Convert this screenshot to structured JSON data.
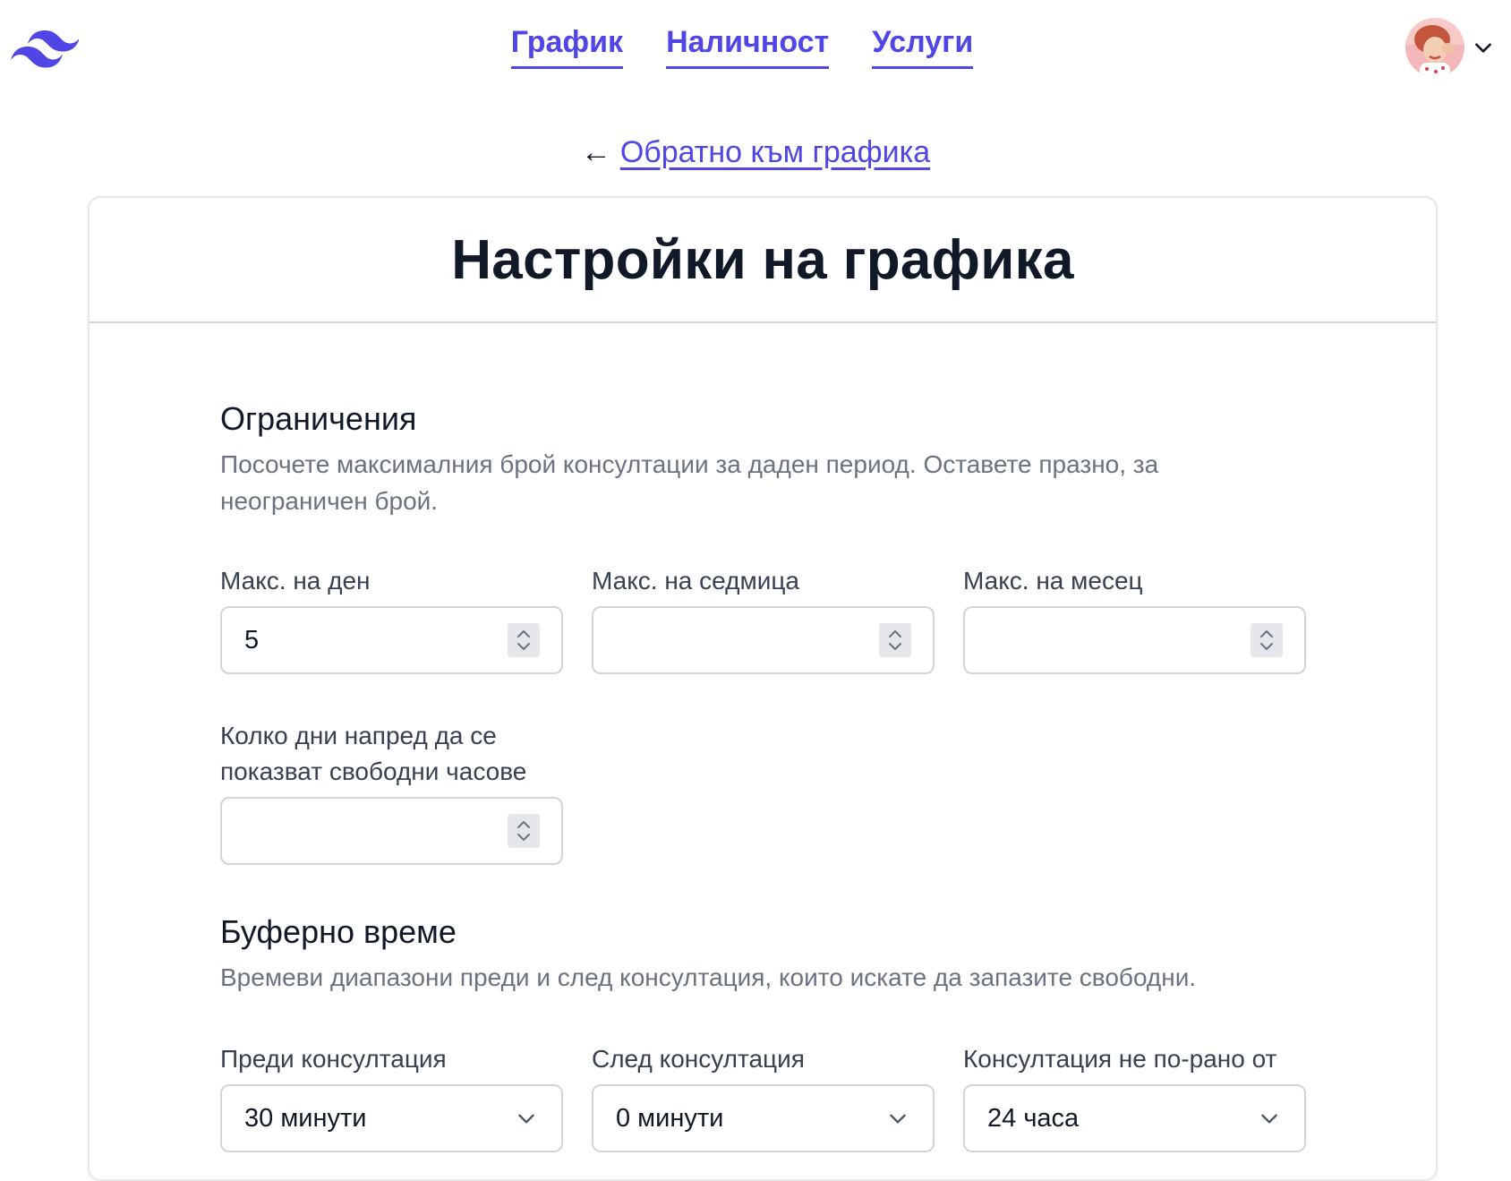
{
  "nav": {
    "items": [
      {
        "label": "График"
      },
      {
        "label": "Наличност"
      },
      {
        "label": "Услуги"
      }
    ]
  },
  "user": {
    "avatar_icon": "user-avatar-photo",
    "menu_icon": "chevron-down-icon"
  },
  "back": {
    "arrow": "←",
    "label": "Обратно към графика"
  },
  "page": {
    "title": "Настройки на графика"
  },
  "limits": {
    "title": "Ограничения",
    "description": "Посочете максималния брой консултации за даден период. Оставете празно, за неограничен брой.",
    "max_per_day": {
      "label": "Макс. на ден",
      "value": "5"
    },
    "max_per_week": {
      "label": "Макс. на седмица",
      "value": ""
    },
    "max_per_month": {
      "label": "Макс. на месец",
      "value": ""
    },
    "days_ahead": {
      "label": "Колко дни напред да се показват свободни часове",
      "value": ""
    }
  },
  "buffer": {
    "title": "Буферно време",
    "description": "Времеви диапазони преди и след консултация, които искате да запазите свободни.",
    "before": {
      "label": "Преди консултация",
      "value": "30 минути"
    },
    "after": {
      "label": "След консултация",
      "value": "0 минути"
    },
    "earliest": {
      "label": "Консултация не по-рано от",
      "value": "24 часа"
    }
  },
  "colors": {
    "accent": "#4f46e5",
    "text": "#111827",
    "muted": "#6b7280",
    "border": "#d1d5db"
  }
}
